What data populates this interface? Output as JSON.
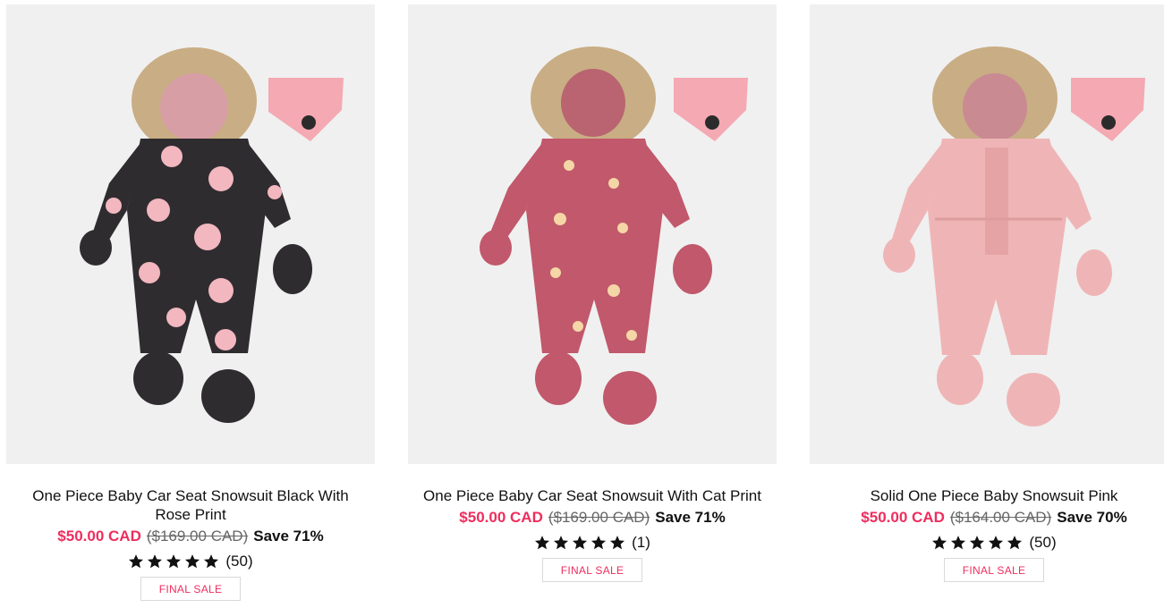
{
  "products": [
    {
      "title": "One Piece Baby Car Seat Snowsuit Black With Rose Print",
      "sale_price": "$50.00 CAD",
      "original_price": "($169.00 CAD)",
      "save": "Save 71%",
      "rating": 5,
      "review_count": "(50)",
      "badge": "FINAL SALE",
      "suit_color": "#2f2c30",
      "print_color": "#f2b7bf",
      "cap_color": "#f4a9b3"
    },
    {
      "title": "One Piece Baby Car Seat Snowsuit With Cat Print",
      "sale_price": "$50.00 CAD",
      "original_price": "($169.00 CAD)",
      "save": "Save 71%",
      "rating": 5,
      "review_count": "(1)",
      "badge": "FINAL SALE",
      "suit_color": "#c1586b",
      "print_color": "#f5d6a6",
      "cap_color": "#f4a9b3"
    },
    {
      "title": "Solid One Piece Baby Snowsuit Pink",
      "sale_price": "$50.00 CAD",
      "original_price": "($164.00 CAD)",
      "save": "Save 70%",
      "rating": 5,
      "review_count": "(50)",
      "badge": "FINAL SALE",
      "suit_color": "#efb5b6",
      "print_color": "#efb5b6",
      "cap_color": "#f4a9b3"
    }
  ],
  "colors": {
    "sale": "#ef2d5e",
    "fur": "#c9ad84",
    "card_bg": "#f0f0f0"
  }
}
